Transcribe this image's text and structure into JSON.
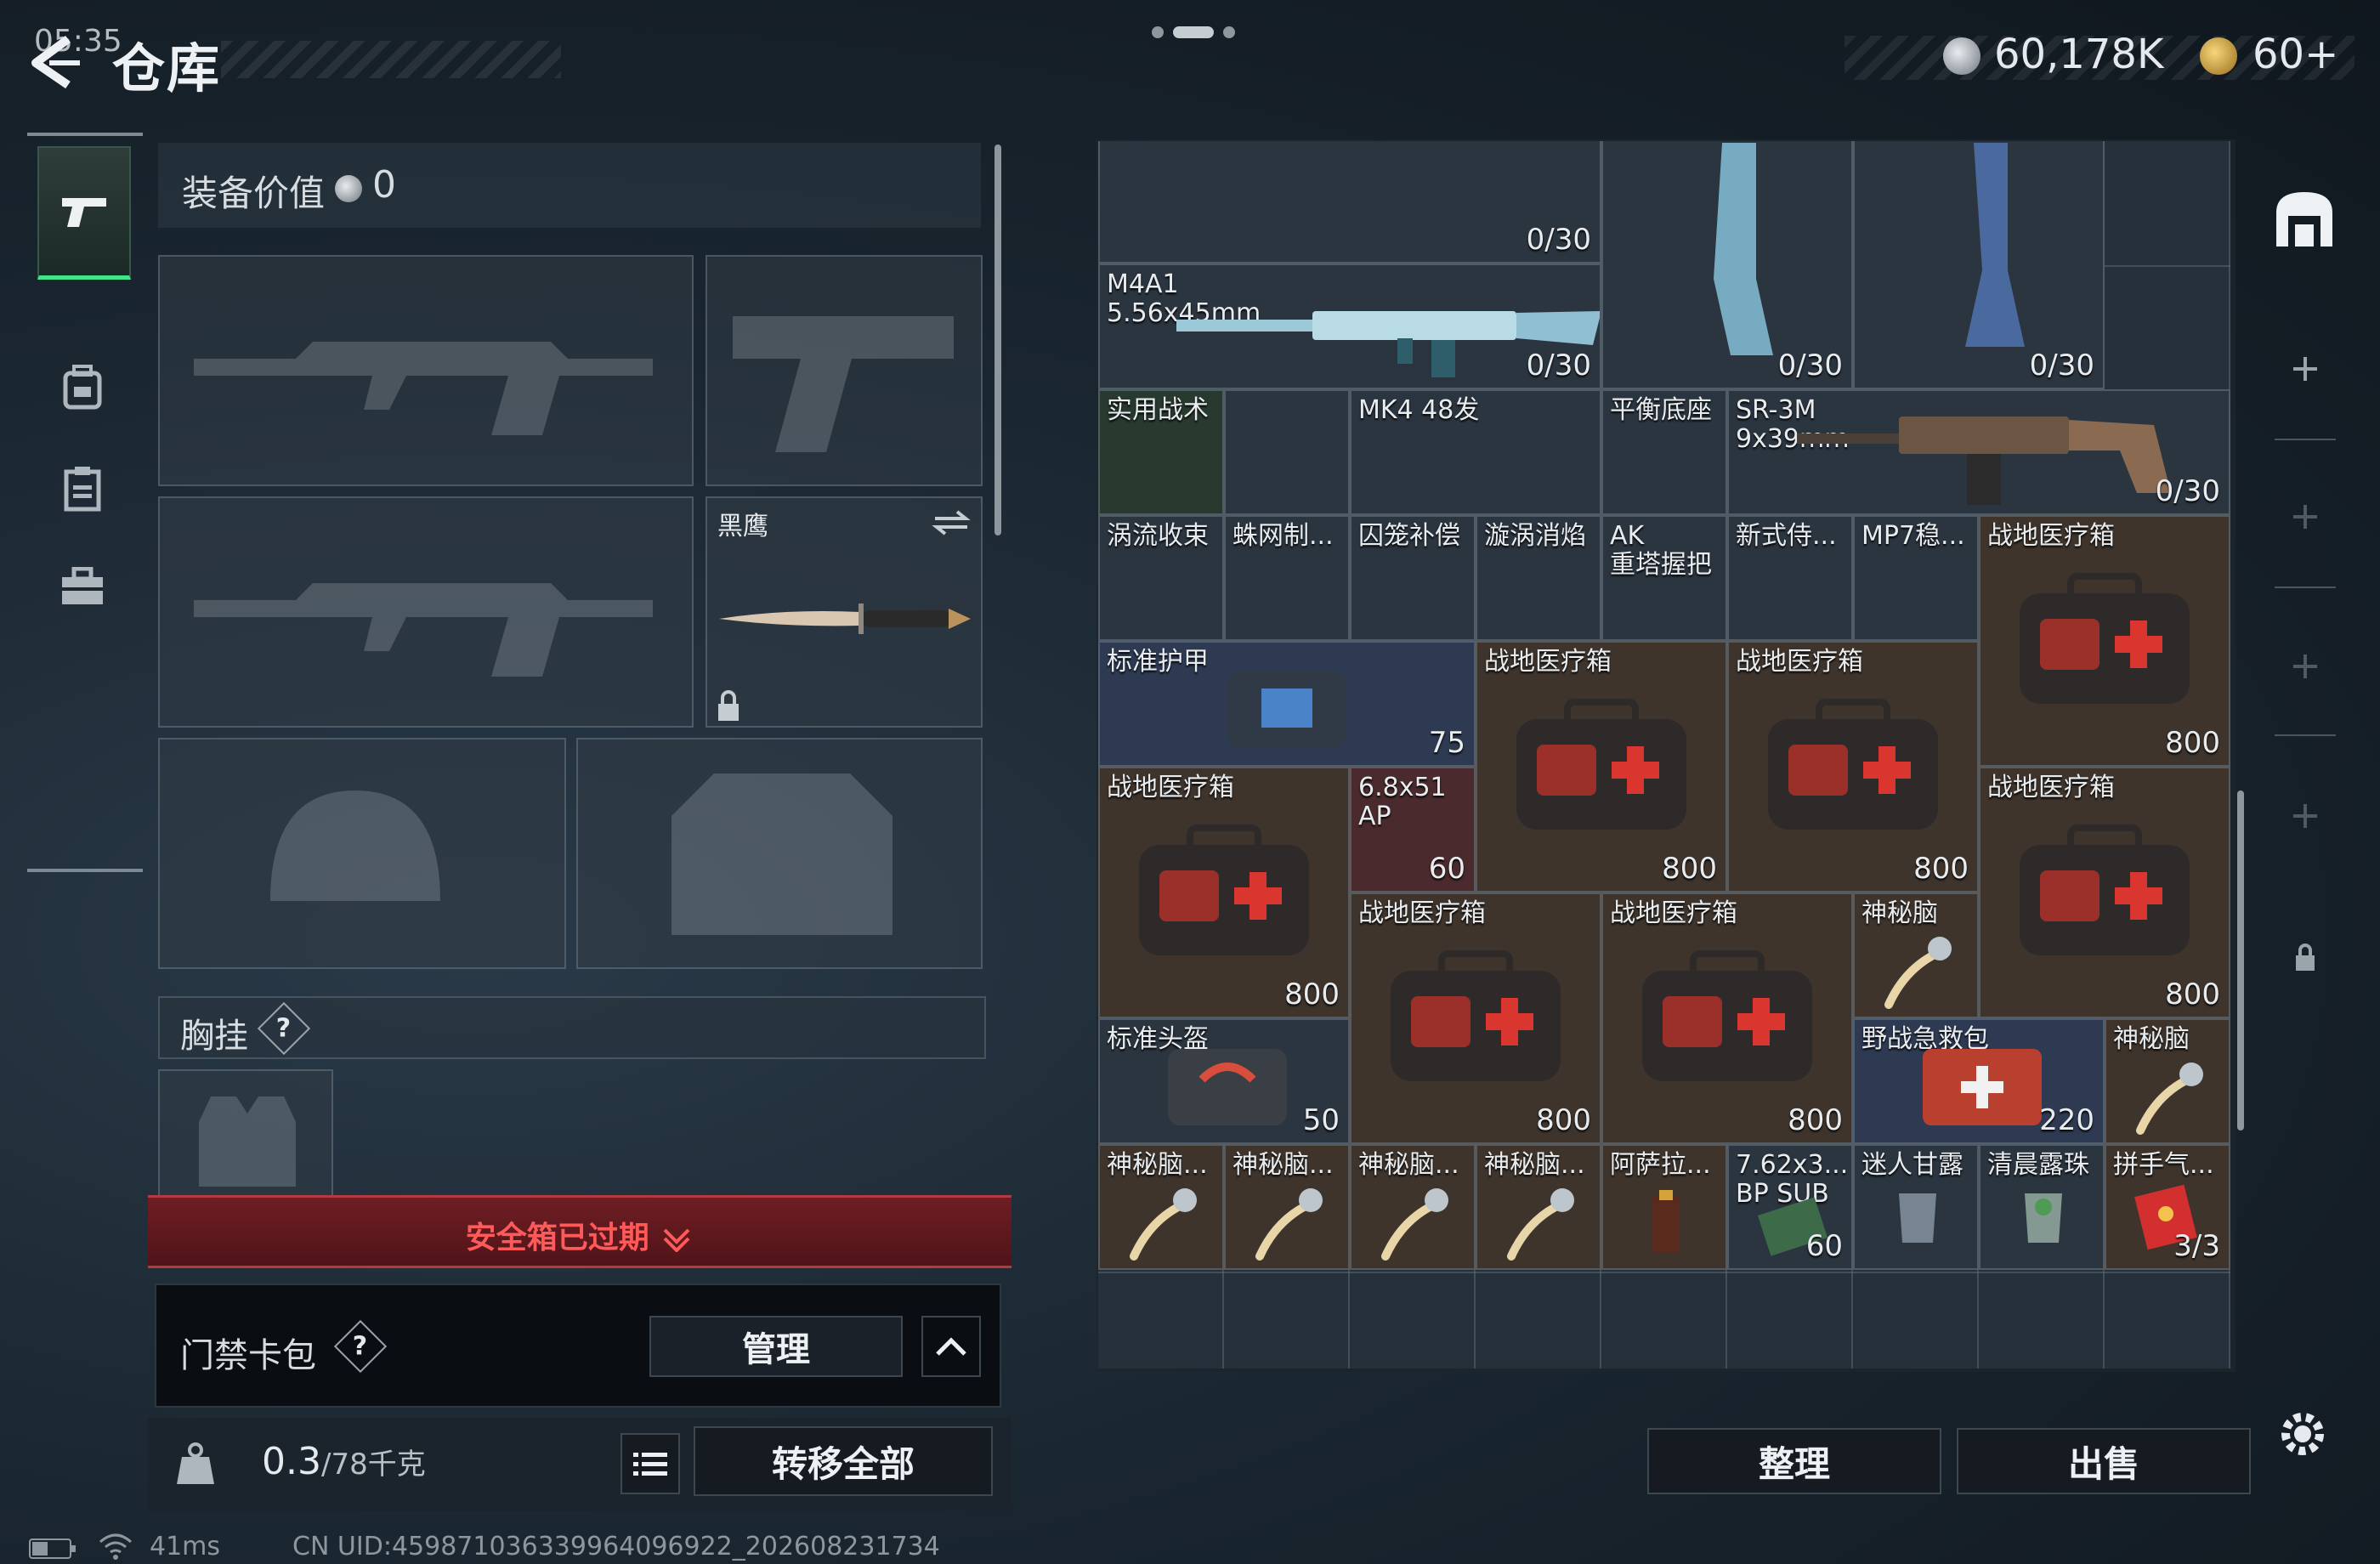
{
  "status": {
    "time": "05:35",
    "ping": "41ms",
    "uid": "CN UID:459871036339964096922_202608231734"
  },
  "header": {
    "title": "仓库",
    "money": "60,178K",
    "gold": "60+"
  },
  "equipment": {
    "value_label": "装备价值",
    "value": "0",
    "melee_name": "黑鹰",
    "chest_label": "胸挂",
    "safe_box_status": "安全箱已过期",
    "card_pack_label": "门禁卡包",
    "manage_label": "管理",
    "weight_current": "0.3",
    "weight_max": "/78千克",
    "transfer_all_label": "转移全部"
  },
  "storage": {
    "sort_label": "整理",
    "sell_label": "出售",
    "items": [
      {
        "label": "",
        "count": "0/30"
      },
      {
        "label": "",
        "count": "0/30"
      },
      {
        "label": "",
        "count": "0/30"
      },
      {
        "label": "M4A1\n5.56x45mm",
        "count": "0/30"
      },
      {
        "label": "SR-3M\n9x39mm",
        "count": "0/30"
      },
      {
        "label": "实用战术",
        "count": ""
      },
      {
        "label": "MK4 48发",
        "count": ""
      },
      {
        "label": "平衡底座",
        "count": ""
      },
      {
        "label": "涡流收束",
        "count": ""
      },
      {
        "label": "蛛网制...",
        "count": ""
      },
      {
        "label": "囚笼补偿",
        "count": ""
      },
      {
        "label": "漩涡消焰",
        "count": ""
      },
      {
        "label": "AK\n重塔握把",
        "count": ""
      },
      {
        "label": "新式侍...",
        "count": ""
      },
      {
        "label": "MP7稳...",
        "count": ""
      },
      {
        "label": "战地医疗箱",
        "count": "800"
      },
      {
        "label": "标准护甲",
        "count": "75"
      },
      {
        "label": "战地医疗箱",
        "count": "800"
      },
      {
        "label": "战地医疗箱",
        "count": "800"
      },
      {
        "label": "战地医疗箱",
        "count": "800"
      },
      {
        "label": "6.8x51\nAP",
        "count": "60"
      },
      {
        "label": "战地医疗箱",
        "count": "800"
      },
      {
        "label": "战地医疗箱",
        "count": "800"
      },
      {
        "label": "战地医疗箱",
        "count": "800"
      },
      {
        "label": "神秘脑",
        "count": ""
      },
      {
        "label": "标准头盔",
        "count": "50"
      },
      {
        "label": "野战急救包",
        "count": "220"
      },
      {
        "label": "神秘脑",
        "count": ""
      },
      {
        "label": "神秘脑...",
        "count": ""
      },
      {
        "label": "神秘脑...",
        "count": ""
      },
      {
        "label": "神秘脑...",
        "count": ""
      },
      {
        "label": "神秘脑...",
        "count": ""
      },
      {
        "label": "阿萨拉...",
        "count": ""
      },
      {
        "label": "7.62x3...\nBP SUB",
        "count": "60"
      },
      {
        "label": "迷人甘露",
        "count": ""
      },
      {
        "label": "清晨露珠",
        "count": ""
      },
      {
        "label": "拼手气...",
        "count": "3/3"
      }
    ]
  }
}
